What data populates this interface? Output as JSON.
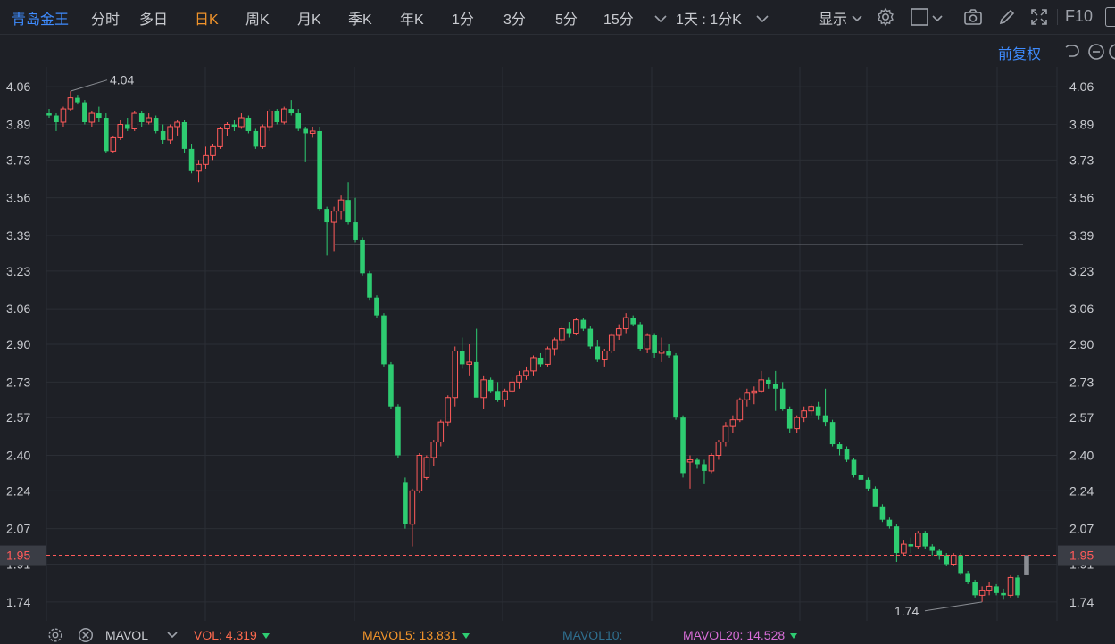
{
  "toolbar": {
    "stock_name": "青岛金王",
    "periods": [
      "分时",
      "多日",
      "日K",
      "周K",
      "月K",
      "季K",
      "年K",
      "1分",
      "3分",
      "5分",
      "15分"
    ],
    "active_period": "日K",
    "more_period_icon": "chevron-down-icon",
    "range_selector": "1天 : 1分K",
    "display_label": "显示",
    "f10_label": "F10"
  },
  "subbar": {
    "adjust_label": "前复权"
  },
  "colors": {
    "up": "#ff5a5a",
    "down": "#2ecc71",
    "background": "#1e2026",
    "grid": "#2b2e35",
    "accent": "#3f8cff",
    "active_tab": "#f0932b",
    "price_line": "#ff5a5a"
  },
  "price_axis": {
    "ticks": [
      "4.06",
      "3.89",
      "3.73",
      "3.56",
      "3.39",
      "3.23",
      "3.06",
      "2.90",
      "2.73",
      "2.57",
      "2.40",
      "2.24",
      "2.07",
      "1.91",
      "1.74"
    ],
    "current_price": "1.95",
    "high_label": "4.04",
    "low_label": "1.74",
    "ymin": 1.655,
    "ymax": 4.149
  },
  "indicators": {
    "mavol_label": "MAVOL",
    "vol": "VOL: 4.319",
    "mavol5": "MAVOL5: 13.831",
    "mavol10": "MAVOL10:",
    "mavol20": "MAVOL20: 14.528",
    "vol_color": "#ff6a4d",
    "mavol5_color": "#f0932b",
    "mavol10_color": "#2f6f8f",
    "mavol20_color": "#d86ed8"
  },
  "chart_data": {
    "type": "candlestick",
    "ylim": [
      1.655,
      4.149
    ],
    "reference_line": 3.35,
    "current_price": 1.95,
    "candles": [
      [
        3.94,
        3.96,
        3.92,
        3.93
      ],
      [
        3.93,
        3.94,
        3.86,
        3.9
      ],
      [
        3.9,
        3.97,
        3.88,
        3.96
      ],
      [
        3.96,
        4.04,
        3.95,
        4.01
      ],
      [
        4.01,
        4.02,
        3.98,
        3.99
      ],
      [
        3.99,
        4.0,
        3.89,
        3.9
      ],
      [
        3.9,
        3.95,
        3.88,
        3.94
      ],
      [
        3.94,
        3.97,
        3.9,
        3.92
      ],
      [
        3.92,
        3.94,
        3.76,
        3.77
      ],
      [
        3.77,
        3.84,
        3.76,
        3.83
      ],
      [
        3.83,
        3.91,
        3.82,
        3.89
      ],
      [
        3.89,
        3.92,
        3.86,
        3.87
      ],
      [
        3.87,
        3.95,
        3.86,
        3.94
      ],
      [
        3.94,
        3.95,
        3.88,
        3.9
      ],
      [
        3.9,
        3.94,
        3.89,
        3.92
      ],
      [
        3.92,
        3.93,
        3.85,
        3.86
      ],
      [
        3.86,
        3.89,
        3.8,
        3.82
      ],
      [
        3.82,
        3.89,
        3.8,
        3.88
      ],
      [
        3.88,
        3.91,
        3.84,
        3.9
      ],
      [
        3.9,
        3.91,
        3.76,
        3.78
      ],
      [
        3.78,
        3.8,
        3.67,
        3.68
      ],
      [
        3.68,
        3.73,
        3.63,
        3.71
      ],
      [
        3.71,
        3.79,
        3.69,
        3.75
      ],
      [
        3.75,
        3.8,
        3.73,
        3.79
      ],
      [
        3.79,
        3.88,
        3.78,
        3.87
      ],
      [
        3.87,
        3.9,
        3.84,
        3.89
      ],
      [
        3.89,
        3.91,
        3.86,
        3.88
      ],
      [
        3.88,
        3.94,
        3.87,
        3.92
      ],
      [
        3.92,
        3.93,
        3.85,
        3.86
      ],
      [
        3.86,
        3.87,
        3.78,
        3.79
      ],
      [
        3.79,
        3.89,
        3.78,
        3.88
      ],
      [
        3.88,
        3.96,
        3.86,
        3.95
      ],
      [
        3.95,
        3.96,
        3.89,
        3.9
      ],
      [
        3.9,
        3.97,
        3.89,
        3.96
      ],
      [
        3.96,
        4.0,
        3.93,
        3.94
      ],
      [
        3.94,
        3.96,
        3.86,
        3.87
      ],
      [
        3.87,
        3.88,
        3.72,
        3.85
      ],
      [
        3.85,
        3.88,
        3.83,
        3.86
      ],
      [
        3.86,
        3.88,
        3.5,
        3.51
      ],
      [
        3.51,
        3.52,
        3.3,
        3.45
      ],
      [
        3.45,
        3.52,
        3.32,
        3.5
      ],
      [
        3.5,
        3.57,
        3.46,
        3.55
      ],
      [
        3.55,
        3.63,
        3.44,
        3.45
      ],
      [
        3.45,
        3.56,
        3.36,
        3.37
      ],
      [
        3.37,
        3.38,
        3.21,
        3.22
      ],
      [
        3.22,
        3.23,
        3.1,
        3.11
      ],
      [
        3.11,
        3.12,
        3.02,
        3.03
      ],
      [
        3.03,
        3.04,
        2.8,
        2.81
      ],
      [
        2.81,
        2.82,
        2.61,
        2.62
      ],
      [
        2.62,
        2.63,
        2.39,
        2.4
      ],
      [
        2.28,
        2.3,
        2.07,
        2.09
      ],
      [
        2.09,
        2.25,
        1.99,
        2.24
      ],
      [
        2.24,
        2.41,
        2.23,
        2.4
      ],
      [
        2.3,
        2.4,
        2.29,
        2.39
      ],
      [
        2.39,
        2.47,
        2.35,
        2.46
      ],
      [
        2.46,
        2.56,
        2.44,
        2.55
      ],
      [
        2.55,
        2.67,
        2.53,
        2.66
      ],
      [
        2.66,
        2.89,
        2.62,
        2.87
      ],
      [
        2.87,
        2.93,
        2.79,
        2.81
      ],
      [
        2.81,
        2.9,
        2.76,
        2.82
      ],
      [
        2.82,
        2.97,
        2.8,
        2.66
      ],
      [
        2.66,
        2.76,
        2.61,
        2.74
      ],
      [
        2.74,
        2.75,
        2.68,
        2.69
      ],
      [
        2.69,
        2.73,
        2.64,
        2.65
      ],
      [
        2.65,
        2.7,
        2.62,
        2.69
      ],
      [
        2.69,
        2.75,
        2.68,
        2.73
      ],
      [
        2.73,
        2.78,
        2.7,
        2.76
      ],
      [
        2.76,
        2.8,
        2.74,
        2.78
      ],
      [
        2.78,
        2.85,
        2.76,
        2.84
      ],
      [
        2.84,
        2.86,
        2.8,
        2.81
      ],
      [
        2.81,
        2.89,
        2.8,
        2.88
      ],
      [
        2.88,
        2.93,
        2.85,
        2.92
      ],
      [
        2.92,
        2.98,
        2.9,
        2.97
      ],
      [
        2.97,
        3.0,
        2.93,
        2.95
      ],
      [
        2.95,
        3.02,
        2.94,
        3.01
      ],
      [
        3.01,
        3.02,
        2.96,
        2.97
      ],
      [
        2.97,
        2.98,
        2.88,
        2.89
      ],
      [
        2.89,
        2.92,
        2.82,
        2.83
      ],
      [
        2.83,
        2.88,
        2.8,
        2.87
      ],
      [
        2.87,
        2.95,
        2.86,
        2.94
      ],
      [
        2.94,
        2.99,
        2.92,
        2.97
      ],
      [
        2.97,
        3.04,
        2.95,
        3.02
      ],
      [
        3.02,
        3.03,
        2.98,
        2.99
      ],
      [
        2.99,
        3.0,
        2.87,
        2.88
      ],
      [
        2.88,
        2.95,
        2.86,
        2.94
      ],
      [
        2.94,
        2.95,
        2.84,
        2.86
      ],
      [
        2.86,
        2.93,
        2.82,
        2.87
      ],
      [
        2.87,
        2.9,
        2.84,
        2.85
      ],
      [
        2.85,
        2.86,
        2.56,
        2.57
      ],
      [
        2.57,
        2.58,
        2.3,
        2.32
      ],
      [
        2.37,
        2.4,
        2.25,
        2.38
      ],
      [
        2.38,
        2.39,
        2.34,
        2.36
      ],
      [
        2.36,
        2.38,
        2.27,
        2.33
      ],
      [
        2.33,
        2.41,
        2.32,
        2.4
      ],
      [
        2.4,
        2.47,
        2.38,
        2.46
      ],
      [
        2.46,
        2.55,
        2.44,
        2.53
      ],
      [
        2.53,
        2.58,
        2.5,
        2.56
      ],
      [
        2.56,
        2.66,
        2.55,
        2.65
      ],
      [
        2.65,
        2.7,
        2.62,
        2.68
      ],
      [
        2.68,
        2.71,
        2.63,
        2.69
      ],
      [
        2.69,
        2.78,
        2.68,
        2.74
      ],
      [
        2.74,
        2.75,
        2.7,
        2.72
      ],
      [
        2.72,
        2.78,
        2.6,
        2.7
      ],
      [
        2.7,
        2.73,
        2.6,
        2.61
      ],
      [
        2.61,
        2.62,
        2.5,
        2.52
      ],
      [
        2.52,
        2.58,
        2.5,
        2.57
      ],
      [
        2.57,
        2.62,
        2.55,
        2.6
      ],
      [
        2.6,
        2.63,
        2.58,
        2.62
      ],
      [
        2.62,
        2.64,
        2.56,
        2.58
      ],
      [
        2.58,
        2.7,
        2.53,
        2.55
      ],
      [
        2.55,
        2.56,
        2.44,
        2.45
      ],
      [
        2.45,
        2.46,
        2.4,
        2.43
      ],
      [
        2.43,
        2.44,
        2.37,
        2.38
      ],
      [
        2.38,
        2.39,
        2.3,
        2.31
      ],
      [
        2.31,
        2.32,
        2.26,
        2.29
      ],
      [
        2.29,
        2.3,
        2.24,
        2.25
      ],
      [
        2.25,
        2.26,
        2.18,
        2.17
      ],
      [
        2.17,
        2.18,
        2.1,
        2.11
      ],
      [
        2.11,
        2.12,
        2.07,
        2.08
      ],
      [
        2.08,
        2.09,
        1.92,
        1.96
      ],
      [
        1.96,
        2.02,
        1.95,
        2.0
      ],
      [
        2.0,
        2.03,
        1.96,
        1.99
      ],
      [
        1.99,
        2.06,
        1.98,
        2.05
      ],
      [
        2.05,
        2.06,
        1.98,
        1.99
      ],
      [
        1.99,
        2.0,
        1.95,
        1.97
      ],
      [
        1.97,
        1.98,
        1.93,
        1.95
      ],
      [
        1.95,
        1.96,
        1.9,
        1.91
      ],
      [
        1.91,
        1.96,
        1.9,
        1.95
      ],
      [
        1.95,
        1.96,
        1.86,
        1.87
      ],
      [
        1.87,
        1.88,
        1.82,
        1.83
      ],
      [
        1.83,
        1.84,
        1.76,
        1.77
      ],
      [
        1.77,
        1.81,
        1.74,
        1.79
      ],
      [
        1.79,
        1.83,
        1.77,
        1.81
      ],
      [
        1.81,
        1.82,
        1.77,
        1.78
      ],
      [
        1.78,
        1.8,
        1.75,
        1.77
      ],
      [
        1.77,
        1.86,
        1.76,
        1.85
      ],
      [
        1.85,
        1.86,
        1.76,
        1.77
      ]
    ]
  }
}
